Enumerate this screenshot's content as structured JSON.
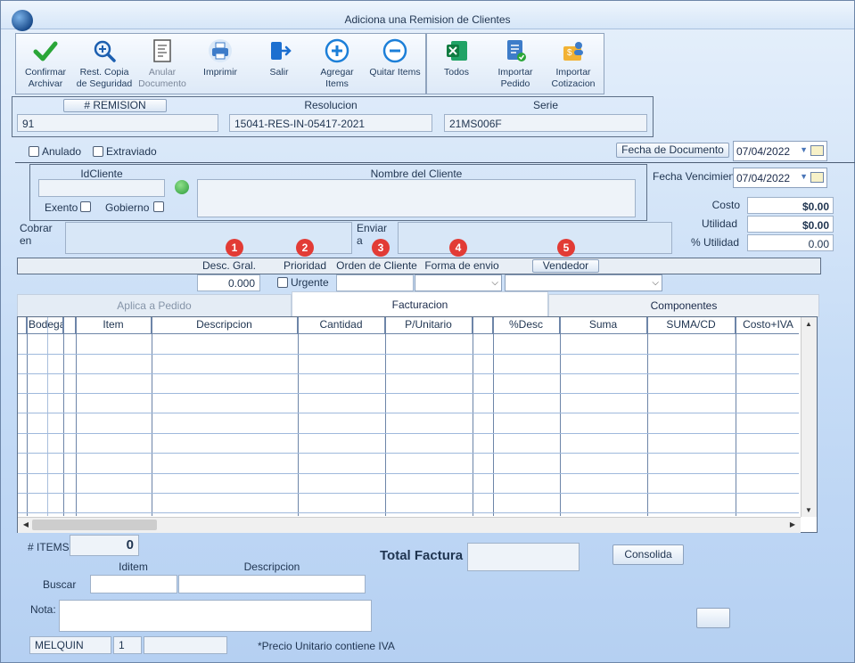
{
  "window": {
    "title": "Adiciona una Remision de Clientes"
  },
  "toolbar": {
    "confirmar": "Confirmar Archivar",
    "restcopia": "Rest. Copia de Seguridad",
    "anular": "Anular Documento",
    "imprimir": "Imprimir",
    "salir": "Salir",
    "agregar": "Agregar Items",
    "quitar": "Quitar Items",
    "todos": "Todos",
    "importar_pedido": "Importar Pedido",
    "importar_cotizacion": "Importar Cotizacion"
  },
  "header": {
    "remision_label": "# REMISION",
    "remision_value": "91",
    "resolucion_label": "Resolucion",
    "resolucion_value": "15041-RES-IN-05417-2021",
    "serie_label": "Serie",
    "serie_value": "21MS006F"
  },
  "flags": {
    "anulado": "Anulado",
    "extraviado": "Extraviado"
  },
  "dates": {
    "fecha_documento_label": "Fecha de  Documento",
    "fecha_documento": "07/04/2022",
    "fecha_vencimiento_label": "Fecha Vencimien",
    "fecha_vencimiento": "07/04/2022"
  },
  "cliente": {
    "id_label": "IdCliente",
    "nombre_label": "Nombre del Cliente",
    "exento": "Exento",
    "gobierno": "Gobierno",
    "cobrar_label": "Cobrar en",
    "enviar_label": "Enviar a"
  },
  "totals": {
    "costo_label": "Costo",
    "costo": "$0.00",
    "utilidad_label": "Utilidad",
    "utilidad": "$0.00",
    "pct_utilidad_label": "% Utilidad",
    "pct_utilidad": "0.00"
  },
  "options": {
    "desc_label": "Desc. Gral.",
    "desc_value": "0.000",
    "prioridad_label": "Prioridad",
    "urgente": "Urgente",
    "orden_label": "Orden de Cliente",
    "forma_label": "Forma de envio",
    "vendedor_label": "Vendedor",
    "badges": [
      "1",
      "2",
      "3",
      "4",
      "5"
    ]
  },
  "tabs": [
    "Aplica a Pedido",
    "Facturacion",
    "Componentes"
  ],
  "grid": {
    "columns": [
      "Bodega",
      "Item",
      "Descripcion",
      "Cantidad",
      "P/Unitario",
      "%Desc",
      "Suma",
      "SUMA/CD",
      "Costo+IVA"
    ]
  },
  "footer": {
    "items_label": "# ITEMS",
    "items_value": "0",
    "total_label": "Total Factura",
    "consolida": "Consolida",
    "iditem_label": "Iditem",
    "descripcion_label": "Descripcion",
    "buscar_label": "Buscar",
    "nota_label": "Nota:",
    "user": "MELQUIN",
    "user_num": "1",
    "precio_note": "*Precio Unitario contiene IVA"
  }
}
